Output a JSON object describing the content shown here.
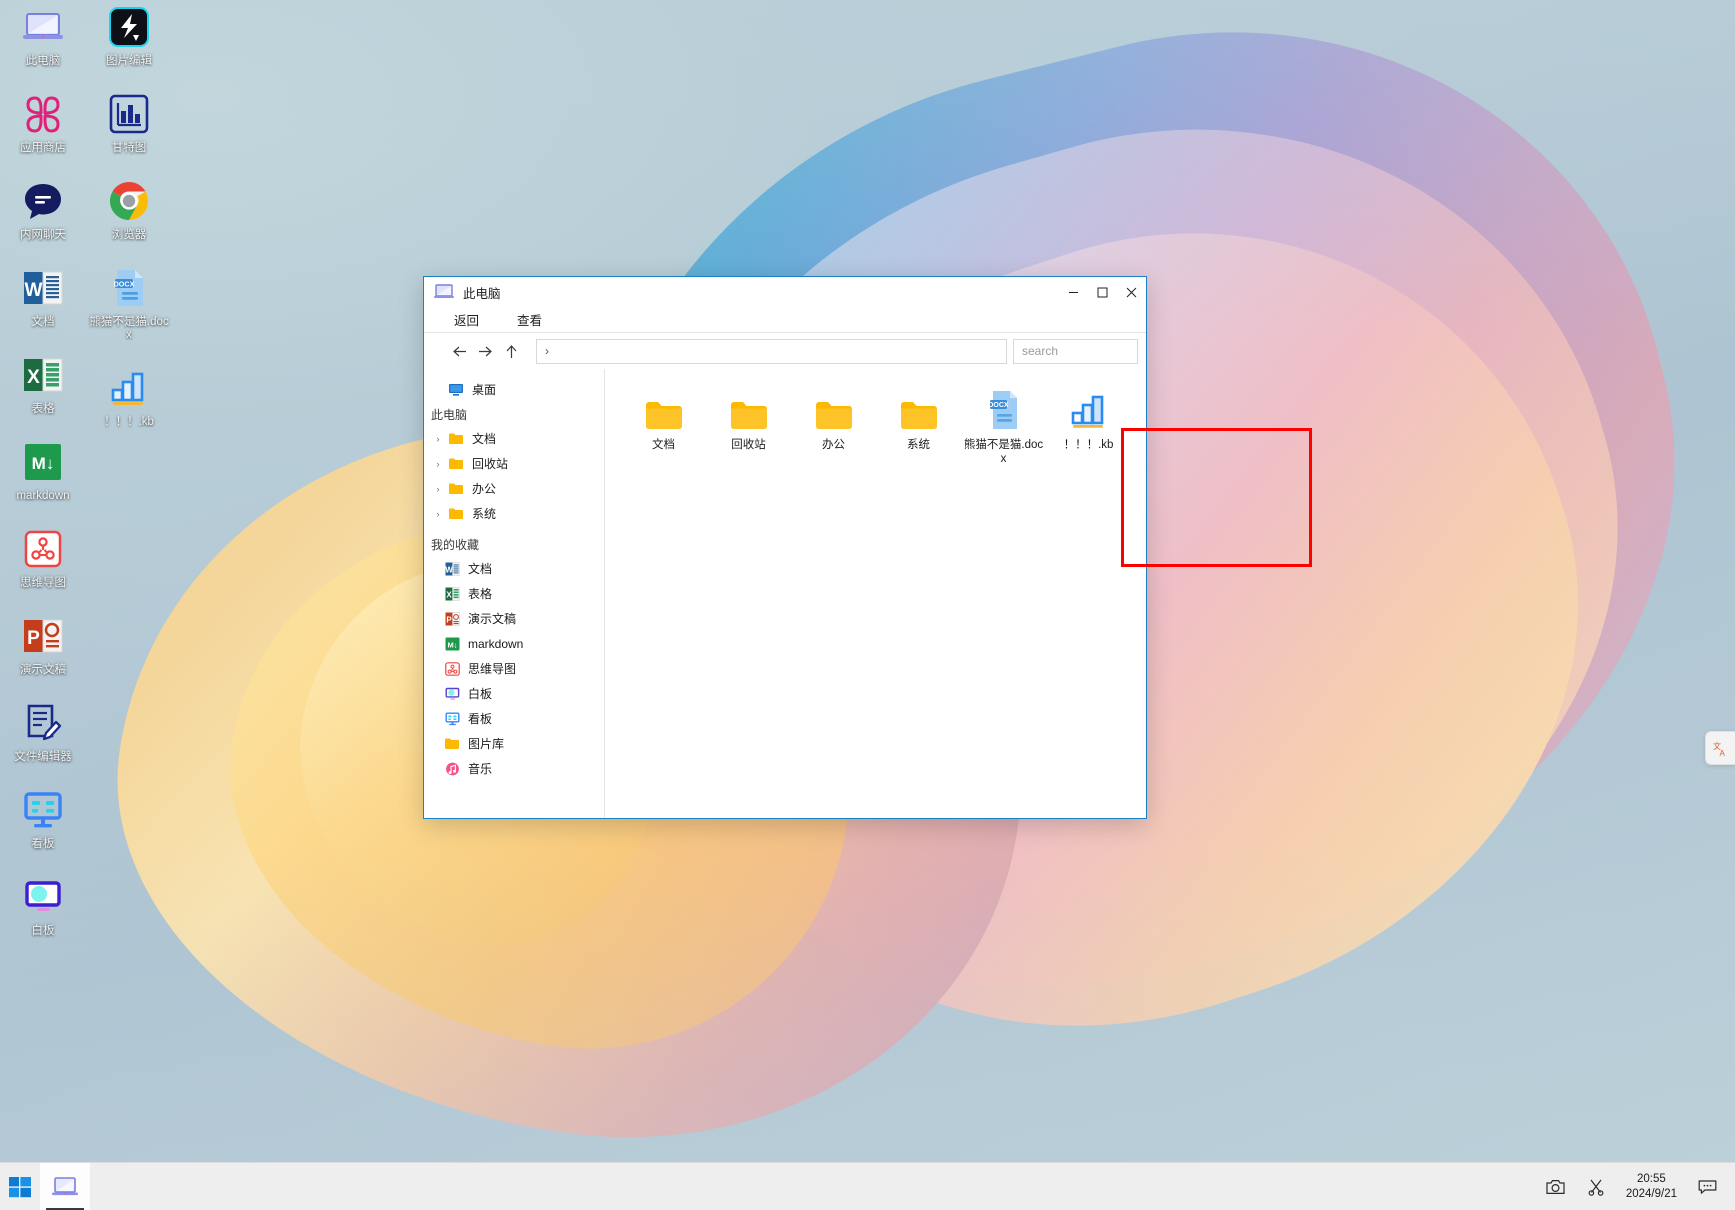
{
  "desktop": {
    "icons_left": [
      {
        "label": "此电脑",
        "icon": "computer-icon"
      },
      {
        "label": "应用商店",
        "icon": "app-store-icon"
      },
      {
        "label": "内网聊天",
        "icon": "chat-icon"
      },
      {
        "label": "文档",
        "icon": "word-icon"
      },
      {
        "label": "表格",
        "icon": "excel-icon"
      },
      {
        "label": "markdown",
        "icon": "markdown-icon"
      },
      {
        "label": "思维导图",
        "icon": "mindmap-icon"
      },
      {
        "label": "演示文稿",
        "icon": "powerpoint-icon"
      },
      {
        "label": "文件编辑器",
        "icon": "file-editor-icon"
      },
      {
        "label": "看板",
        "icon": "kanban-icon"
      },
      {
        "label": "白板",
        "icon": "whiteboard-icon"
      }
    ],
    "icons_right": [
      {
        "label": "图片编辑",
        "icon": "image-editor-icon"
      },
      {
        "label": "甘特图",
        "icon": "gantt-chart-icon"
      },
      {
        "label": "浏览器",
        "icon": "chrome-browser-icon"
      },
      {
        "label": "熊猫不是猫.docx",
        "icon": "docx-file-icon"
      },
      {
        "label": "！！！.kb",
        "icon": "bar-chart-file-icon"
      }
    ]
  },
  "window": {
    "title": "此电脑",
    "title_icon": "computer-icon",
    "controls": {
      "minimize": "—",
      "maximize": "▢",
      "close": "✕"
    },
    "menu": [
      "返回",
      "查看"
    ],
    "nav": {
      "back": "←",
      "forward": "→",
      "up": "↑"
    },
    "path": {
      "value": "",
      "separator": "›"
    },
    "search": {
      "placeholder": "search",
      "value": ""
    },
    "sidebar": {
      "desktop": {
        "label": "桌面",
        "icon": "monitor-icon"
      },
      "this_pc_header": "此电脑",
      "tree": [
        {
          "label": "文档",
          "icon": "folder-icon",
          "chevron": "›"
        },
        {
          "label": "回收站",
          "icon": "folder-icon",
          "chevron": "›"
        },
        {
          "label": "办公",
          "icon": "folder-icon",
          "chevron": "›"
        },
        {
          "label": "系统",
          "icon": "folder-icon",
          "chevron": "›"
        }
      ],
      "favorites_header": "我的收藏",
      "favorites": [
        {
          "label": "文档",
          "icon": "word-icon"
        },
        {
          "label": "表格",
          "icon": "excel-icon"
        },
        {
          "label": "演示文稿",
          "icon": "powerpoint-icon"
        },
        {
          "label": "markdown",
          "icon": "markdown-icon"
        },
        {
          "label": "思维导图",
          "icon": "mindmap-icon"
        },
        {
          "label": "白板",
          "icon": "whiteboard-icon"
        },
        {
          "label": "看板",
          "icon": "kanban-icon"
        },
        {
          "label": "图片库",
          "icon": "folder-icon"
        },
        {
          "label": "音乐",
          "icon": "music-icon"
        }
      ]
    },
    "files": [
      {
        "label": "文档",
        "icon": "folder-icon"
      },
      {
        "label": "回收站",
        "icon": "folder-icon"
      },
      {
        "label": "办公",
        "icon": "folder-icon"
      },
      {
        "label": "系统",
        "icon": "folder-icon"
      },
      {
        "label": "熊猫不是猫.docx",
        "icon": "docx-file-icon"
      },
      {
        "label": "！！！.kb",
        "icon": "bar-chart-file-icon"
      }
    ]
  },
  "annotation": {
    "highlight_color": "#fe0000",
    "shape": "rectangle"
  },
  "taskbar": {
    "start": "windows-logo-icon",
    "tasks": [
      {
        "label": "此电脑",
        "icon": "computer-icon"
      }
    ],
    "tray": [
      {
        "name": "camera-icon"
      },
      {
        "name": "scissors-icon"
      }
    ],
    "clock": {
      "time": "20:55",
      "date": "2024/9/21"
    },
    "notification": "chat-bubble-icon"
  },
  "translate_widget": {
    "icon": "translate-icon"
  }
}
